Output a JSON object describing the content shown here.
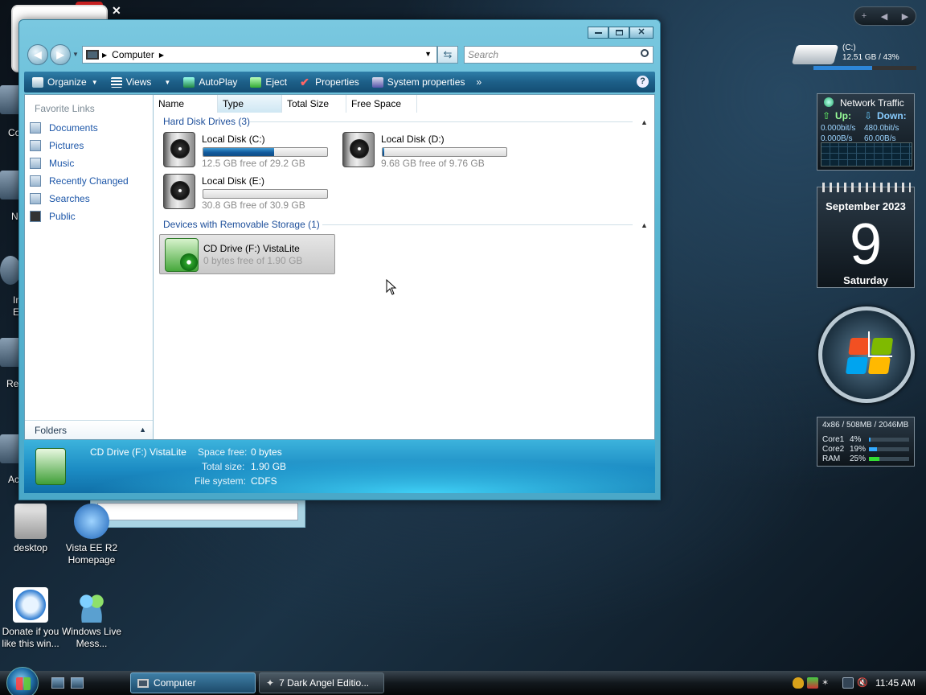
{
  "desktop": {
    "icons": [
      {
        "label": "desktop"
      },
      {
        "label": "Vista EE R2 Homepage"
      },
      {
        "label": "Donate if you like this win..."
      },
      {
        "label": "Windows Live Mess..."
      }
    ],
    "partial_labels": [
      "Co",
      "N",
      "In",
      "E",
      "Rec",
      "Ac"
    ]
  },
  "window": {
    "address": {
      "crumb": "Computer"
    },
    "search": {
      "placeholder": "Search"
    },
    "toolbar": {
      "organize": "Organize",
      "views": "Views",
      "autoplay": "AutoPlay",
      "eject": "Eject",
      "properties": "Properties",
      "system_properties": "System properties",
      "more": "»",
      "help": "?"
    },
    "nav": {
      "header": "Favorite Links",
      "items": [
        "Documents",
        "Pictures",
        "Music",
        "Recently Changed",
        "Searches",
        "Public"
      ],
      "folders": "Folders"
    },
    "columns": [
      "Name",
      "Type",
      "Total Size",
      "Free Space"
    ],
    "groups": [
      {
        "title": "Hard Disk Drives (3)"
      },
      {
        "title": "Devices with Removable Storage (1)"
      }
    ],
    "drives": [
      {
        "name": "Local Disk (C:)",
        "free": "12.5 GB free of 29.2 GB",
        "used_fraction": 0.57
      },
      {
        "name": "Local Disk (D:)",
        "free": "9.68 GB free of 9.76 GB",
        "used_fraction": 0.01
      },
      {
        "name": "Local Disk (E:)",
        "free": "30.8 GB free of 30.9 GB",
        "used_fraction": 0.0
      }
    ],
    "cd": {
      "name": "CD Drive (F:) VistaLite",
      "free": "0 bytes free of 1.90 GB"
    },
    "details": {
      "name": "CD Drive (F:) VistaLite",
      "space_free_label": "Space free:",
      "space_free": "0 bytes",
      "total_size_label": "Total size:",
      "total_size": "1.90 GB",
      "fs_label": "File system:",
      "fs": "CDFS"
    }
  },
  "gadgets": {
    "drive": {
      "label": "(C:)",
      "info": "12.51 GB / 43%",
      "used_fraction": 0.57
    },
    "network": {
      "title": "Network Traffic",
      "up": "Up:",
      "down": "Down:",
      "up_bits": "0.000bit/s",
      "down_bits": "480.0bit/s",
      "up_bytes": "0.000B/s",
      "down_bytes": "60.00B/s"
    },
    "calendar": {
      "month": "September 2023",
      "day": "9",
      "weekday": "Saturday"
    },
    "cpu": {
      "header": "4x86 / 508MB / 2046MB",
      "rows": [
        {
          "label": "Core1",
          "value": "4%",
          "fraction": 0.04
        },
        {
          "label": "Core2",
          "value": "19%",
          "fraction": 0.19
        },
        {
          "label": "RAM",
          "value": "25%",
          "fraction": 0.25
        }
      ]
    }
  },
  "taskbar": {
    "tasks": [
      "Computer",
      "7 Dark Angel Editio..."
    ],
    "clock": "11:45 AM"
  }
}
